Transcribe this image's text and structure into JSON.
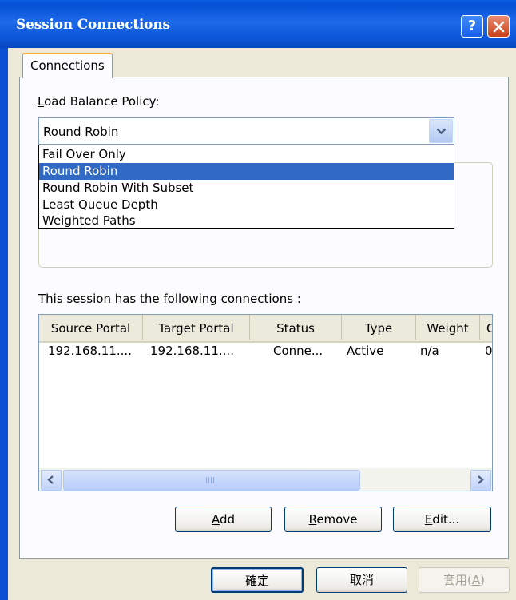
{
  "window": {
    "title": "Session Connections"
  },
  "tabs": [
    {
      "label": "Connections"
    }
  ],
  "load_balance": {
    "label_accel": "L",
    "label_rest": "oad Balance Policy:",
    "selected": "Round Robin",
    "options": [
      "Fail Over Only",
      "Round Robin",
      "Round Robin With Subset",
      "Least Queue Depth",
      "Weighted Paths"
    ]
  },
  "connections": {
    "label_pre": "This session has the following ",
    "label_accel": "c",
    "label_post": "onnections :",
    "columns": [
      "Source Portal",
      "Target Portal",
      "Status",
      "Type",
      "Weight",
      "C"
    ],
    "rows": [
      {
        "source": "192.168.11....",
        "target": "192.168.11....",
        "status": "Conne...",
        "type": "Active",
        "weight": "n/a",
        "extra": "0"
      }
    ]
  },
  "buttons": {
    "add": {
      "accel": "A",
      "rest": "dd"
    },
    "remove": {
      "accel": "R",
      "rest": "emove"
    },
    "edit": {
      "accel": "E",
      "rest": "dit..."
    },
    "ok": "確定",
    "cancel": "取消",
    "apply": {
      "pre": "套用(",
      "accel": "A",
      "post": ")"
    }
  },
  "icons": {
    "help": "?",
    "close": "close-icon",
    "combo_arrow": "chevron-down-icon",
    "scroll_left": "arrow-left-icon",
    "scroll_right": "arrow-right-icon"
  },
  "colors": {
    "titlebar": "#0450d6",
    "selection": "#316ac5",
    "tab_highlight": "#f6a836"
  }
}
